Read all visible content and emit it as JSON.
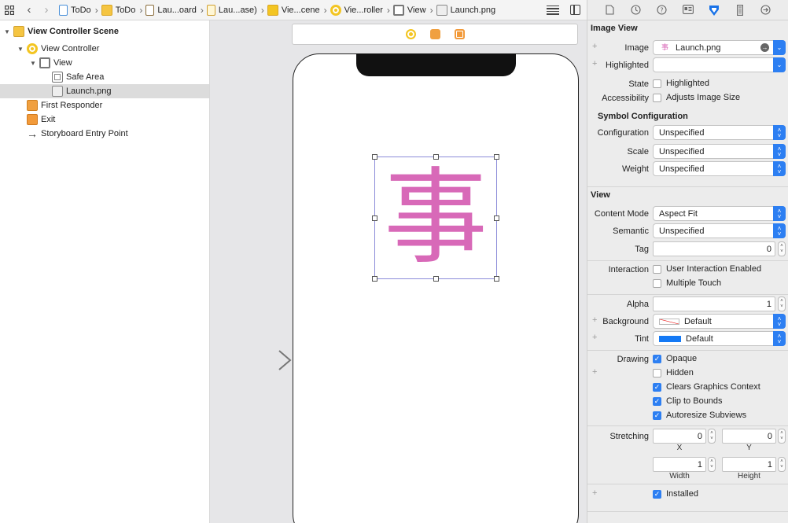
{
  "jumpbar": {
    "crumbs": [
      {
        "label": "ToDo",
        "icon": "file-icon"
      },
      {
        "label": "ToDo",
        "icon": "folder-icon"
      },
      {
        "label": "Lau...oard",
        "icon": "storyboard-icon"
      },
      {
        "label": "Lau...ase)",
        "icon": "storyboard-file-icon"
      },
      {
        "label": "Vie...cene",
        "icon": "scene-icon"
      },
      {
        "label": "Vie...roller",
        "icon": "view-controller-icon"
      },
      {
        "label": "View",
        "icon": "view-icon"
      },
      {
        "label": "Launch.png",
        "icon": "image-icon"
      }
    ]
  },
  "outline": {
    "scene": "View Controller Scene",
    "view_controller": "View Controller",
    "view": "View",
    "safe_area": "Safe Area",
    "launch": "Launch.png",
    "first_responder": "First Responder",
    "exit": "Exit",
    "entry_point": "Storyboard Entry Point"
  },
  "canvas": {
    "image_glyph": "事"
  },
  "inspector": {
    "image_view_title": "Image View",
    "image_label": "Image",
    "image_value": "Launch.png",
    "highlighted_label": "Highlighted",
    "highlighted_value": "",
    "state_label": "State",
    "state_highlighted": "Highlighted",
    "accessibility_label": "Accessibility",
    "adjusts_image_size": "Adjusts Image Size",
    "symbol_title": "Symbol Configuration",
    "configuration_label": "Configuration",
    "configuration_value": "Unspecified",
    "scale_label": "Scale",
    "scale_value": "Unspecified",
    "weight_label": "Weight",
    "weight_value": "Unspecified",
    "view_title": "View",
    "content_mode_label": "Content Mode",
    "content_mode_value": "Aspect Fit",
    "semantic_label": "Semantic",
    "semantic_value": "Unspecified",
    "tag_label": "Tag",
    "tag_value": "0",
    "interaction_label": "Interaction",
    "user_interaction": "User Interaction Enabled",
    "multiple_touch": "Multiple Touch",
    "alpha_label": "Alpha",
    "alpha_value": "1",
    "background_label": "Background",
    "background_value": "Default",
    "tint_label": "Tint",
    "tint_value": "Default",
    "drawing_label": "Drawing",
    "opaque": "Opaque",
    "hidden": "Hidden",
    "clears_graphics": "Clears Graphics Context",
    "clip_to_bounds": "Clip to Bounds",
    "autoresize": "Autoresize Subviews",
    "stretching_label": "Stretching",
    "stretch_x": "0",
    "stretch_y": "0",
    "x_label": "X",
    "y_label": "Y",
    "stretch_w": "1",
    "stretch_h": "1",
    "width_label": "Width",
    "height_label": "Height",
    "installed": "Installed",
    "accent_color": "#2d7ff2",
    "tint_color": "#1479f5"
  }
}
